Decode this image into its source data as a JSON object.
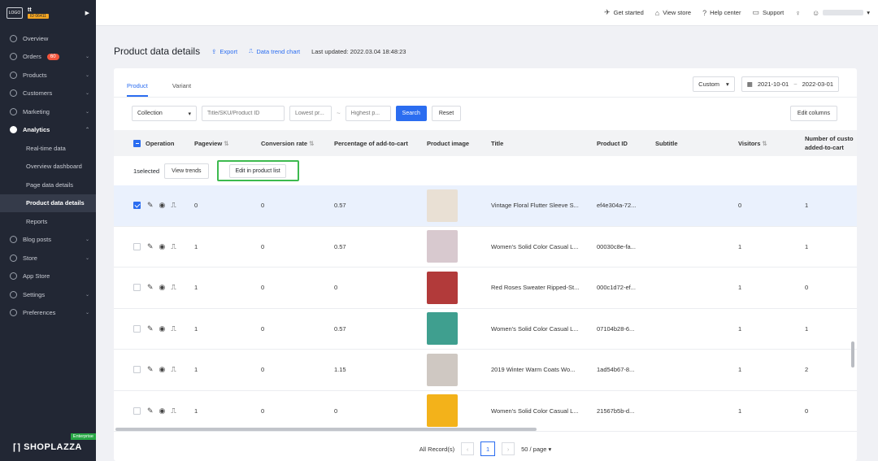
{
  "store": {
    "name": "tt",
    "id_badge": "ID 06411",
    "logo_text": "LOGO"
  },
  "sidebar": {
    "items": [
      {
        "label": "Overview",
        "icon": "overview-icon"
      },
      {
        "label": "Orders",
        "badge": "60",
        "icon": "orders-icon"
      },
      {
        "label": "Products",
        "icon": "products-icon"
      },
      {
        "label": "Customers",
        "icon": "customers-icon"
      },
      {
        "label": "Marketing",
        "icon": "marketing-icon"
      },
      {
        "label": "Analytics",
        "icon": "analytics-icon"
      },
      {
        "label": "Blog posts",
        "icon": "blog-icon"
      },
      {
        "label": "Store",
        "icon": "store-icon"
      },
      {
        "label": "App Store",
        "icon": "app-store-icon"
      },
      {
        "label": "Settings",
        "icon": "settings-icon"
      },
      {
        "label": "Preferences",
        "icon": "preferences-icon"
      }
    ],
    "analytics_sub": [
      "Real-time data",
      "Overview dashboard",
      "Page data details",
      "Product data details",
      "Reports"
    ],
    "footer_brand": "SHOPLAZZA",
    "footer_tier": "Enterprise"
  },
  "topbar": {
    "get_started": "Get started",
    "view_store": "View store",
    "help_center": "Help center",
    "support": "Support"
  },
  "page": {
    "title": "Product data details",
    "export": "Export",
    "trend_chart": "Data trend chart",
    "last_updated": "Last updated: 2022.03.04 18:48:23"
  },
  "tabs": [
    "Product",
    "Variant"
  ],
  "range": {
    "mode": "Custom",
    "start": "2021-10-01",
    "sep": "~",
    "end": "2022-03-01"
  },
  "filters": {
    "collection": "Collection",
    "search_placeholder": "Title/SKU/Product ID",
    "lowest_placeholder": "Lowest pr...",
    "range_sep": "~",
    "highest_placeholder": "Highest p...",
    "search_btn": "Search",
    "reset_btn": "Reset",
    "edit_columns": "Edit columns"
  },
  "table": {
    "headers": {
      "operation": "Operation",
      "pageview": "Pageview",
      "conversion": "Conversion rate",
      "add_to_cart_pct": "Percentage of add-to-cart",
      "image": "Product image",
      "title": "Title",
      "product_id": "Product ID",
      "subtitle": "Subtitle",
      "visitors": "Visitors",
      "customers_added_1": "Number of custo",
      "customers_added_2": "added-to-cart"
    },
    "selection": {
      "count_text": "1selected",
      "view_trends": "View trends",
      "edit_in_list": "Edit in product list"
    },
    "rows": [
      {
        "pageview": "0",
        "conversion": "0",
        "atc": "0.57",
        "title": "Vintage Floral Flutter Sleeve S...",
        "pid": "ef4e304a-72...",
        "visitors": "0",
        "added": "1",
        "thumb": "#e9e0d4",
        "selected": true
      },
      {
        "pageview": "1",
        "conversion": "0",
        "atc": "0.57",
        "title": "Women's Solid Color Casual L...",
        "pid": "00030c8e-fa...",
        "visitors": "1",
        "added": "1",
        "thumb": "#d8c9cf",
        "selected": false
      },
      {
        "pageview": "1",
        "conversion": "0",
        "atc": "0",
        "title": "Red Roses Sweater Ripped-St...",
        "pid": "000c1d72-ef...",
        "visitors": "1",
        "added": "0",
        "thumb": "#b23a3a",
        "selected": false
      },
      {
        "pageview": "1",
        "conversion": "0",
        "atc": "0.57",
        "title": "Women's Solid Color Casual L...",
        "pid": "07104b28-6...",
        "visitors": "1",
        "added": "1",
        "thumb": "#3f9f8f",
        "selected": false
      },
      {
        "pageview": "1",
        "conversion": "0",
        "atc": "1.15",
        "title": "2019 Winter Warm Coats Wo...",
        "pid": "1ad54b67-8...",
        "visitors": "1",
        "added": "2",
        "thumb": "#cfc8c2",
        "selected": false
      },
      {
        "pageview": "1",
        "conversion": "0",
        "atc": "0",
        "title": "Women's Solid Color Casual L...",
        "pid": "21567b5b-d...",
        "visitors": "1",
        "added": "0",
        "thumb": "#f3b21a",
        "selected": false
      }
    ]
  },
  "pager": {
    "all_records": "All Record(s)",
    "page": "1",
    "per_page": "50 / page"
  },
  "colors": {
    "accent": "#2b6df0",
    "sidebar": "#222734",
    "highlight": "#3dba4f"
  }
}
